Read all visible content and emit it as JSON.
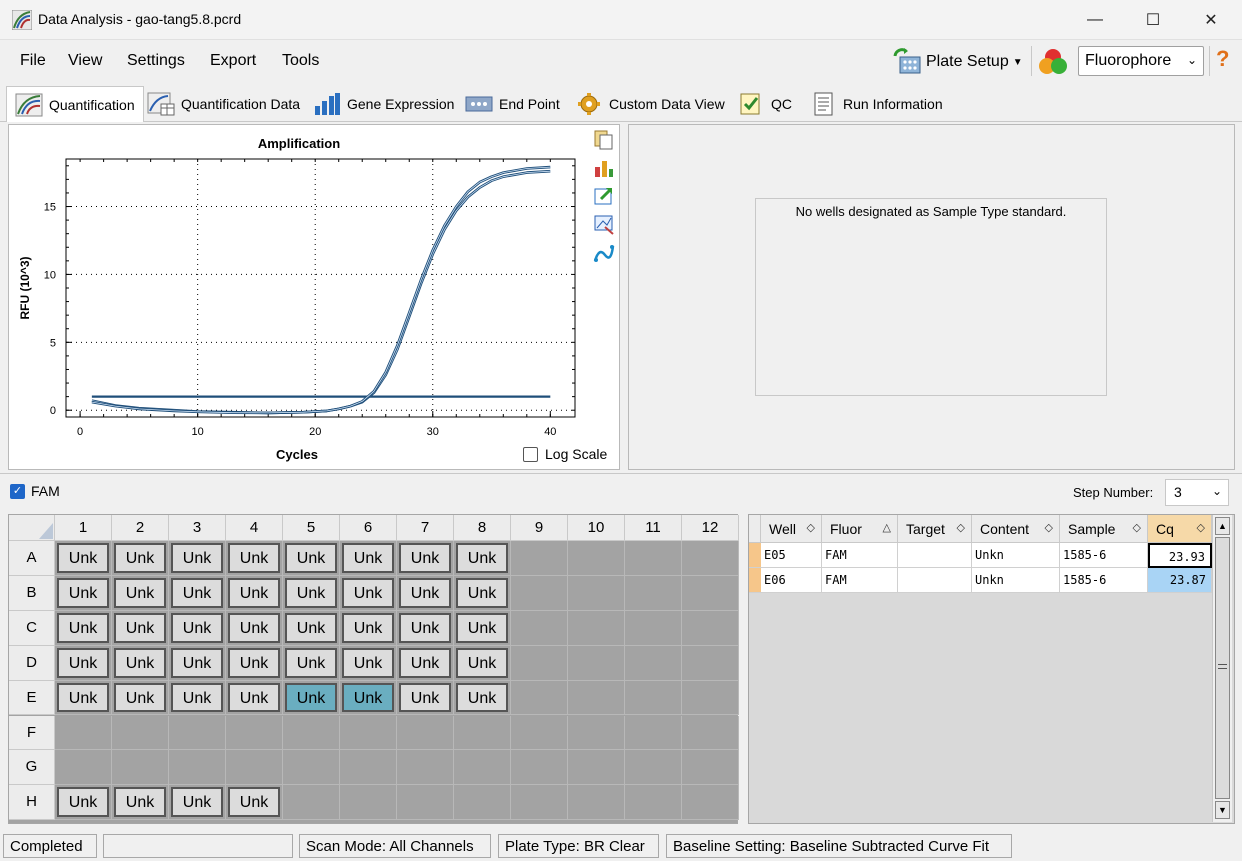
{
  "window": {
    "title": "Data Analysis - gao-tang5.8.pcrd"
  },
  "menu": [
    "File",
    "View",
    "Settings",
    "Export",
    "Tools"
  ],
  "toolbar": {
    "plate_setup": "Plate Setup",
    "fluorophore": "Fluorophore",
    "help": "?"
  },
  "tabs": [
    "Quantification",
    "Quantification Data",
    "Gene Expression",
    "End Point",
    "Custom Data View",
    "QC",
    "Run Information"
  ],
  "chart_data": {
    "type": "line",
    "title": "Amplification",
    "xlabel": "Cycles",
    "ylabel": "RFU (10^3)",
    "xlim": [
      0,
      40
    ],
    "ylim": [
      -0.5,
      18.5
    ],
    "xticks": [
      "0",
      "10",
      "20",
      "30",
      "40"
    ],
    "yticks": [
      "0",
      "5",
      "10",
      "15"
    ],
    "grid": true,
    "threshold": 1.0,
    "series": [
      {
        "x": [
          1,
          3,
          5,
          8,
          10,
          13,
          16,
          19,
          21,
          22,
          23,
          24,
          25,
          26,
          27,
          28,
          29,
          30,
          31,
          32,
          33,
          34,
          35,
          36,
          38,
          40
        ],
        "values": [
          0.7,
          0.35,
          0.15,
          0.0,
          -0.1,
          -0.15,
          -0.2,
          -0.15,
          -0.05,
          0.1,
          0.3,
          0.6,
          1.3,
          2.6,
          4.5,
          6.9,
          9.3,
          11.5,
          13.3,
          14.7,
          15.7,
          16.4,
          16.9,
          17.2,
          17.5,
          17.6
        ]
      },
      {
        "x": [
          1,
          3,
          5,
          8,
          10,
          13,
          16,
          19,
          21,
          22,
          23,
          24,
          25,
          26,
          27,
          28,
          29,
          30,
          31,
          32,
          33,
          34,
          35,
          36,
          38,
          40
        ],
        "values": [
          0.6,
          0.3,
          0.1,
          -0.05,
          -0.12,
          -0.18,
          -0.2,
          -0.15,
          -0.05,
          0.1,
          0.3,
          0.65,
          1.4,
          2.8,
          4.8,
          7.2,
          9.6,
          11.8,
          13.6,
          15.0,
          16.1,
          16.8,
          17.2,
          17.5,
          17.8,
          17.9
        ]
      }
    ],
    "log_scale_label": "Log Scale"
  },
  "standard_curve": {
    "message": "No wells designated as Sample Type standard."
  },
  "fam": {
    "label": "FAM",
    "checked": true
  },
  "step": {
    "label": "Step Number:",
    "value": "3"
  },
  "plate": {
    "cols": [
      "1",
      "2",
      "3",
      "4",
      "5",
      "6",
      "7",
      "8",
      "9",
      "10",
      "11",
      "12"
    ],
    "rows": [
      "A",
      "B",
      "C",
      "D",
      "E",
      "F",
      "G",
      "H"
    ],
    "well_label": "Unk",
    "wells": {
      "A": [
        1,
        1,
        1,
        1,
        1,
        1,
        1,
        1,
        0,
        0,
        0,
        0
      ],
      "B": [
        1,
        1,
        1,
        1,
        1,
        1,
        1,
        1,
        0,
        0,
        0,
        0
      ],
      "C": [
        1,
        1,
        1,
        1,
        1,
        1,
        1,
        1,
        0,
        0,
        0,
        0
      ],
      "D": [
        1,
        1,
        1,
        1,
        1,
        1,
        1,
        1,
        0,
        0,
        0,
        0
      ],
      "E": [
        1,
        1,
        1,
        1,
        2,
        2,
        1,
        1,
        0,
        0,
        0,
        0
      ],
      "F": [
        0,
        0,
        0,
        0,
        0,
        0,
        0,
        0,
        0,
        0,
        0,
        0
      ],
      "G": [
        0,
        0,
        0,
        0,
        0,
        0,
        0,
        0,
        0,
        0,
        0,
        0
      ],
      "H": [
        1,
        1,
        1,
        1,
        0,
        0,
        0,
        0,
        0,
        0,
        0,
        0
      ]
    }
  },
  "table": {
    "headers": [
      "Well",
      "Fluor",
      "Target",
      "Content",
      "Sample",
      "Cq"
    ],
    "rows": [
      [
        "E05",
        "FAM",
        "",
        "Unkn",
        "1585-6",
        "23.93"
      ],
      [
        "E06",
        "FAM",
        "",
        "Unkn",
        "1585-6",
        "23.87"
      ]
    ]
  },
  "status": {
    "state": "Completed",
    "scan_mode": "Scan Mode: All Channels",
    "plate_type": "Plate Type: BR Clear",
    "baseline": "Baseline Setting: Baseline Subtracted Curve Fit"
  }
}
